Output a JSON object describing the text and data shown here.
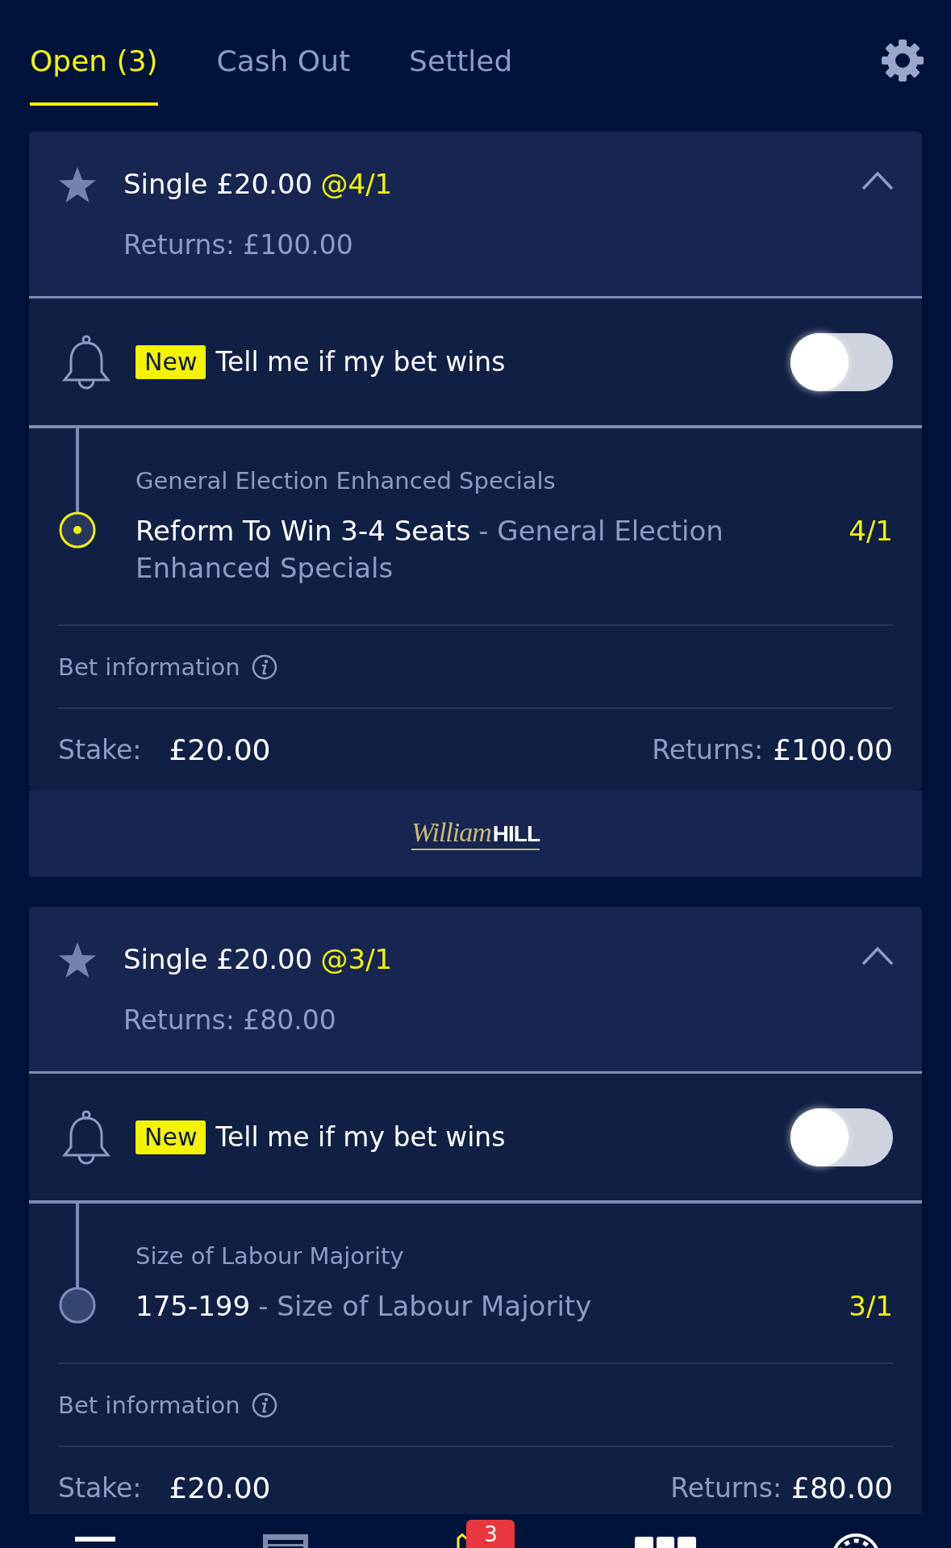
{
  "tabs": [
    {
      "label": "Open (3)",
      "selected": true
    },
    {
      "label": "Cash Out",
      "selected": false
    },
    {
      "label": "Settled",
      "selected": false
    }
  ],
  "bets": [
    {
      "title": "Single £20.00",
      "odds": "@4/1",
      "returns": "Returns: £100.00",
      "starred": false,
      "expanded": true,
      "notification": {
        "badge": "New",
        "text": "Tell me if my bet wins",
        "on": false
      },
      "selection": {
        "market": "General Election Enhanced Specials",
        "name": "Reform To Win 3-4 Seats",
        "event": "- General Election Enhanced Specials",
        "price": "4/1",
        "highlighted": true
      },
      "bet_info": "Bet information",
      "stake_label": "Stake:",
      "stake": "£20.00",
      "returns_label": "Returns:",
      "returns_value": "£100.00",
      "brand": {
        "script": "William",
        "wordmark": "HILL"
      }
    },
    {
      "title": "Single £20.00",
      "odds": "@3/1",
      "returns": "Returns: £80.00",
      "starred": false,
      "expanded": true,
      "notification": {
        "badge": "New",
        "text": "Tell me if my bet wins",
        "on": false
      },
      "selection": {
        "market": "Size of Labour Majority",
        "name": "175-199",
        "event": "- Size of Labour Majority",
        "price": "3/1",
        "highlighted": false
      },
      "bet_info": "Bet information",
      "stake_label": "Stake:",
      "stake": "£20.00",
      "returns_label": "Returns:",
      "returns_value": "£80.00"
    }
  ],
  "bottom_nav": [
    {
      "selected": false
    },
    {
      "selected": false
    },
    {
      "selected": true,
      "badge": "3"
    },
    {
      "selected": false
    },
    {
      "selected": false
    }
  ]
}
